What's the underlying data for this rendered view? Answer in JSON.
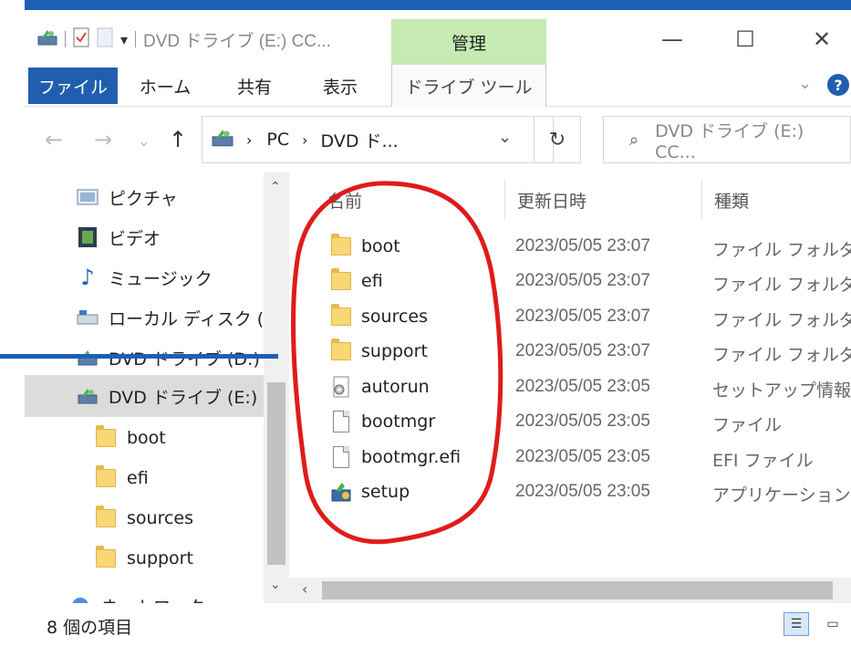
{
  "window": {
    "title": "DVD ドライブ (E:) CC...",
    "manage_tab": "管理",
    "minimize": "—",
    "maximize": "☐",
    "close": "✕"
  },
  "ribbon": {
    "file": "ファイル",
    "home": "ホーム",
    "share": "共有",
    "view": "表示",
    "drive_tools": "ドライブ ツール",
    "help": "?"
  },
  "address": {
    "pc": "PC",
    "drive": "DVD ド...",
    "search_placeholder": "DVD ドライブ (E:) CC..."
  },
  "nav": {
    "items": [
      {
        "label": "ピクチャ",
        "icon": "pictures-icon"
      },
      {
        "label": "ビデオ",
        "icon": "videos-icon"
      },
      {
        "label": "ミュージック",
        "icon": "music-icon"
      },
      {
        "label": "ローカル ディスク (C:",
        "icon": "local-disk-icon"
      },
      {
        "label": "DVD ドライブ (D:) S",
        "icon": "dvd-drive-icon"
      },
      {
        "label": "DVD ドライブ (E:) C",
        "icon": "dvd-drive-icon"
      },
      {
        "label": "boot",
        "icon": "folder-icon"
      },
      {
        "label": "efi",
        "icon": "folder-icon"
      },
      {
        "label": "sources",
        "icon": "folder-icon"
      },
      {
        "label": "support",
        "icon": "folder-icon"
      },
      {
        "label": "ネットワーク",
        "icon": "network-icon"
      }
    ]
  },
  "columns": {
    "name": "名前",
    "modified": "更新日時",
    "type": "種類"
  },
  "files": [
    {
      "name": "boot",
      "date": "2023/05/05 23:07",
      "type": "ファイル フォルダー",
      "icon": "folder-icon"
    },
    {
      "name": "efi",
      "date": "2023/05/05 23:07",
      "type": "ファイル フォルダー",
      "icon": "folder-icon"
    },
    {
      "name": "sources",
      "date": "2023/05/05 23:07",
      "type": "ファイル フォルダー",
      "icon": "folder-icon"
    },
    {
      "name": "support",
      "date": "2023/05/05 23:07",
      "type": "ファイル フォルダー",
      "icon": "folder-icon"
    },
    {
      "name": "autorun",
      "date": "2023/05/05 23:05",
      "type": "セットアップ情報",
      "icon": "setup-info-icon"
    },
    {
      "name": "bootmgr",
      "date": "2023/05/05 23:05",
      "type": "ファイル",
      "icon": "file-icon"
    },
    {
      "name": "bootmgr.efi",
      "date": "2023/05/05 23:05",
      "type": "EFI ファイル",
      "icon": "file-icon"
    },
    {
      "name": "setup",
      "date": "2023/05/05 23:05",
      "type": "アプリケーション",
      "icon": "setup-app-icon"
    }
  ],
  "status": {
    "count": "8 個の項目"
  },
  "colors": {
    "accent": "#1f5fae",
    "manage": "#c5eab2",
    "annotation": "#e01b1b",
    "folder": "#f8d775"
  }
}
